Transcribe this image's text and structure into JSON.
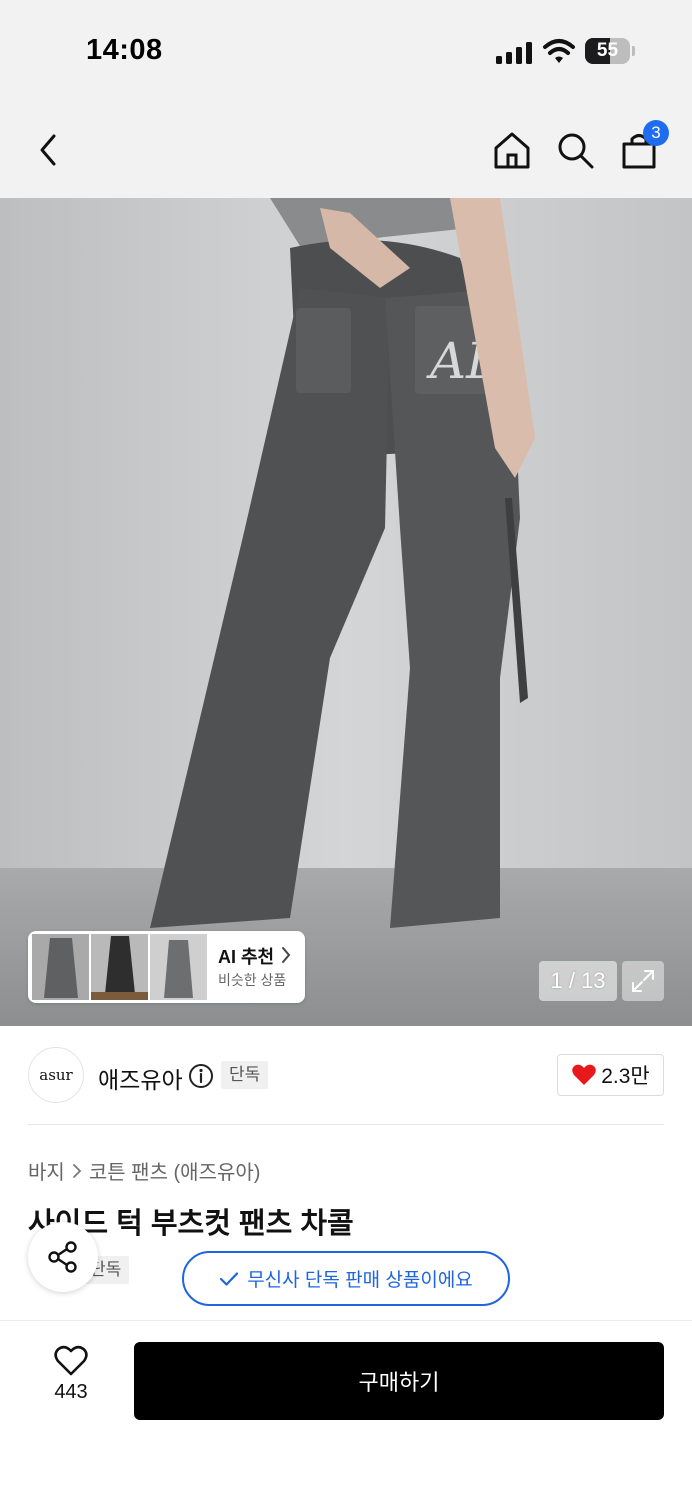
{
  "status_bar": {
    "time": "14:08",
    "battery": "55",
    "battery_level_percent": 55
  },
  "header": {
    "icons": [
      "chevron-left-icon",
      "home-icon",
      "search-icon",
      "shopping-bag-icon"
    ],
    "cart_count": "3"
  },
  "gallery": {
    "ai_title": "AI 추천",
    "ai_subtitle": "비슷한 상품",
    "page_current": "1",
    "page_separator": "/",
    "page_total": "13"
  },
  "brand": {
    "logo_text": "asur",
    "name": "애즈유아",
    "badge": "단독",
    "likes": "2.3만"
  },
  "product": {
    "breadcrumb": [
      "바지",
      "코튼 팬츠 (애즈유아)"
    ],
    "title": "사이드 턱 부츠컷 팬츠 차콜",
    "exclusive_tag": "단독"
  },
  "toast": {
    "text": "무신사 단독 판매 상품이에요"
  },
  "bottom_bar": {
    "wish_count": "443",
    "buy_label": "구매하기"
  },
  "colors": {
    "accent_blue": "#1f64e0",
    "badge_blue": "#1e6cf0",
    "heart_red": "#e8191c",
    "buy_button": "#000000"
  }
}
